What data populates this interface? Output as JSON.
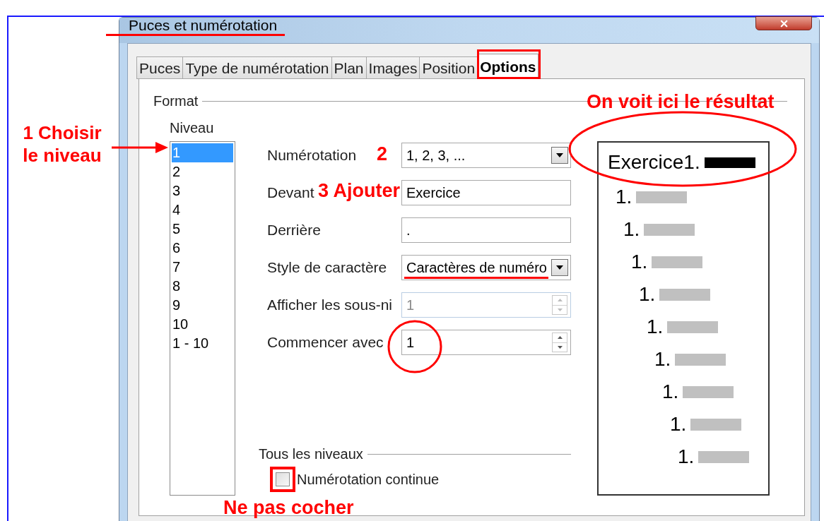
{
  "window": {
    "title": "Puces et numérotation"
  },
  "tabs": [
    {
      "label": "Puces",
      "selected": false
    },
    {
      "label": "Type de numérotation",
      "selected": false
    },
    {
      "label": "Plan",
      "selected": false
    },
    {
      "label": "Images",
      "selected": false
    },
    {
      "label": "Position",
      "selected": false
    },
    {
      "label": "Options",
      "selected": true
    }
  ],
  "format": {
    "legend": "Format",
    "level_label": "Niveau",
    "levels": [
      {
        "label": "1",
        "selected": true
      },
      {
        "label": "2",
        "selected": false
      },
      {
        "label": "3",
        "selected": false
      },
      {
        "label": "4",
        "selected": false
      },
      {
        "label": "5",
        "selected": false
      },
      {
        "label": "6",
        "selected": false
      },
      {
        "label": "7",
        "selected": false
      },
      {
        "label": "8",
        "selected": false
      },
      {
        "label": "9",
        "selected": false
      },
      {
        "label": "10",
        "selected": false
      },
      {
        "label": "1 - 10",
        "selected": false
      }
    ],
    "fields": [
      {
        "label": "Numérotation",
        "kind": "dropdown",
        "value": "1, 2, 3, ...",
        "disabled": false
      },
      {
        "label": "Devant",
        "kind": "text",
        "value": "Exercice",
        "disabled": false
      },
      {
        "label": "Derrière",
        "kind": "text",
        "value": ".",
        "disabled": false
      },
      {
        "label": "Style de caractère",
        "kind": "dropdown",
        "value": "Caractères de numéro",
        "disabled": false
      },
      {
        "label": "Afficher les sous-ni",
        "kind": "spin",
        "value": "1",
        "disabled": true
      },
      {
        "label": "Commencer avec",
        "kind": "spin",
        "value": "1",
        "disabled": false
      }
    ]
  },
  "preview": {
    "lines": [
      {
        "text": "Exercice1.",
        "current": true
      },
      {
        "text": "1.",
        "current": false
      },
      {
        "text": "1.",
        "current": false
      },
      {
        "text": "1.",
        "current": false
      },
      {
        "text": "1.",
        "current": false
      },
      {
        "text": "1.",
        "current": false
      },
      {
        "text": "1.",
        "current": false
      },
      {
        "text": "1.",
        "current": false
      },
      {
        "text": "1.",
        "current": false
      },
      {
        "text": "1.",
        "current": false
      }
    ]
  },
  "all_levels": {
    "legend": "Tous les niveaux",
    "continuous": {
      "label": "Numérotation continue",
      "checked": false
    }
  },
  "annotations": [
    {
      "text": "1 Choisir le niveau"
    },
    {
      "text": "2"
    },
    {
      "text": "3 Ajouter"
    },
    {
      "text": "On voit ici le résultat"
    },
    {
      "text": "Ne pas cocher"
    }
  ]
}
